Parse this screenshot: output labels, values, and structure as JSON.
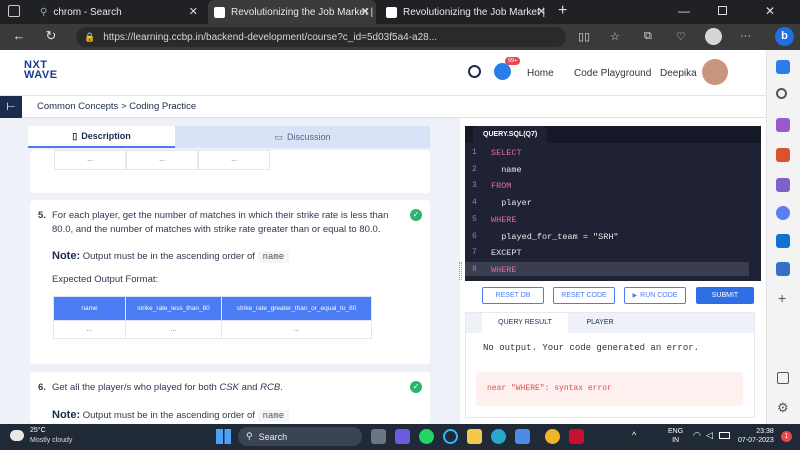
{
  "browser": {
    "tabs": [
      {
        "title": "chrom - Search",
        "active": false,
        "icon": "search-icon"
      },
      {
        "title": "Revolutionizing the Job Market |",
        "active": true,
        "icon": "nxtwave-favicon"
      },
      {
        "title": "Revolutionizing the Job Market |",
        "active": false,
        "icon": "nxtwave-favicon"
      }
    ],
    "url": "https://learning.ccbp.in/backend-development/course?c_id=5d03f5a4-a28..."
  },
  "header": {
    "logo_line1": "NXT",
    "logo_line2": "WAVE",
    "notif_badge": "99+",
    "nav": [
      "Home",
      "Code Playground"
    ],
    "user": "Deepika"
  },
  "breadcrumb": "Common Concepts > Coding Practice",
  "panel_tabs": [
    "Description",
    "Discussion"
  ],
  "prev_table": {
    "cells": [
      "...",
      "...",
      "..."
    ]
  },
  "q5": {
    "number": "5.",
    "text": "For each player, get the number of matches in which their strike rate is less than 80.0, and the number of matches with strike rate greater than or equal to 80.0.",
    "note_label": "Note:",
    "note_text": "Output must be in the ascending order of",
    "note_code": "name",
    "format_label": "Expected Output Format:",
    "columns": [
      "name",
      "strike_rate_less_than_80",
      "strike_rate_greater_than_or_equal_to_80"
    ],
    "row": [
      "...",
      "...",
      "..."
    ]
  },
  "q6": {
    "number": "6.",
    "text_pre": "Get all the player/s who played for both ",
    "team1": "CSK",
    "text_mid": " and ",
    "team2": "RCB",
    "text_post": ".",
    "note_label": "Note:",
    "note_text": "Output must be in the ascending order of",
    "note_code": "name"
  },
  "editor": {
    "file_tab": "QUERY.SQL(Q7)",
    "lines": [
      {
        "n": "1",
        "parts": [
          {
            "t": "SELECT",
            "k": "kw"
          }
        ]
      },
      {
        "n": "2",
        "parts": [
          {
            "t": "  name",
            "k": "id"
          }
        ]
      },
      {
        "n": "3",
        "parts": [
          {
            "t": "FROM",
            "k": "kw"
          }
        ]
      },
      {
        "n": "4",
        "parts": [
          {
            "t": "  player",
            "k": "id"
          }
        ]
      },
      {
        "n": "5",
        "parts": [
          {
            "t": "WHERE",
            "k": "kw"
          }
        ]
      },
      {
        "n": "6",
        "parts": [
          {
            "t": "  played_for_team = ",
            "k": "id"
          },
          {
            "t": "\"SRH\"",
            "k": "str"
          }
        ]
      },
      {
        "n": "7",
        "parts": [
          {
            "t": "EXCEPT",
            "k": "id"
          }
        ]
      },
      {
        "n": "8",
        "parts": [
          {
            "t": "WHERE",
            "k": "kw"
          }
        ]
      }
    ],
    "buttons": [
      "RESET DB",
      "RESET CODE",
      "RUN CODE",
      "SUBMIT"
    ]
  },
  "result": {
    "tabs": [
      "QUERY RESULT",
      "PLAYER"
    ],
    "message": "No output. Your code generated an error.",
    "error": "near \"WHERE\": syntax error"
  },
  "taskbar": {
    "temp": "25°C",
    "weather": "Mostly cloudy",
    "search": "Search",
    "lang1": "ENG",
    "lang2": "IN",
    "time": "23:38",
    "date": "07-07-2023"
  },
  "colors": {
    "accent": "#4b7cf3",
    "editor_bg": "#1e2233",
    "keyword": "#e86aa4",
    "success": "#2db36f",
    "error_text": "#d9534f"
  }
}
